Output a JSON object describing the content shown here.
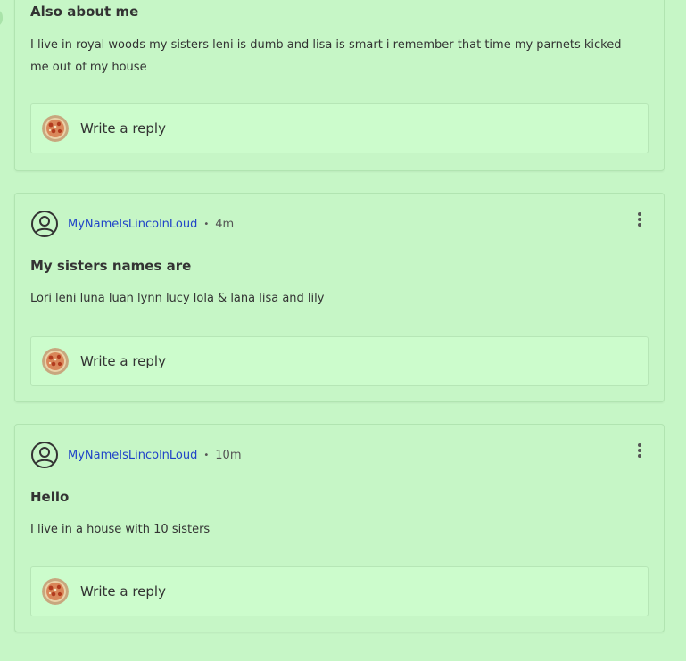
{
  "icons": {
    "user_avatar": "user-circle-icon",
    "menu": "more-vertical-icon",
    "reply_avatar": "pizza-avatar"
  },
  "colors": {
    "background": "#c6f6c6",
    "username_link": "#2044c8",
    "text": "#333333"
  },
  "posts": [
    {
      "title": "Also about me",
      "body": "I live in royal woods my sisters leni is dumb and lisa is smart i remember that time my parnets kicked me out of my house",
      "reply_placeholder": "Write a reply"
    },
    {
      "username": "MyNameIsLincolnLoud",
      "separator": "•",
      "time": "4m",
      "title": "My sisters names are",
      "body": "Lori leni luna luan lynn lucy lola & lana lisa and lily",
      "reply_placeholder": "Write a reply"
    },
    {
      "username": "MyNameIsLincolnLoud",
      "separator": "•",
      "time": "10m",
      "title": "Hello",
      "body": "I live in a house with 10 sisters",
      "reply_placeholder": "Write a reply"
    }
  ]
}
